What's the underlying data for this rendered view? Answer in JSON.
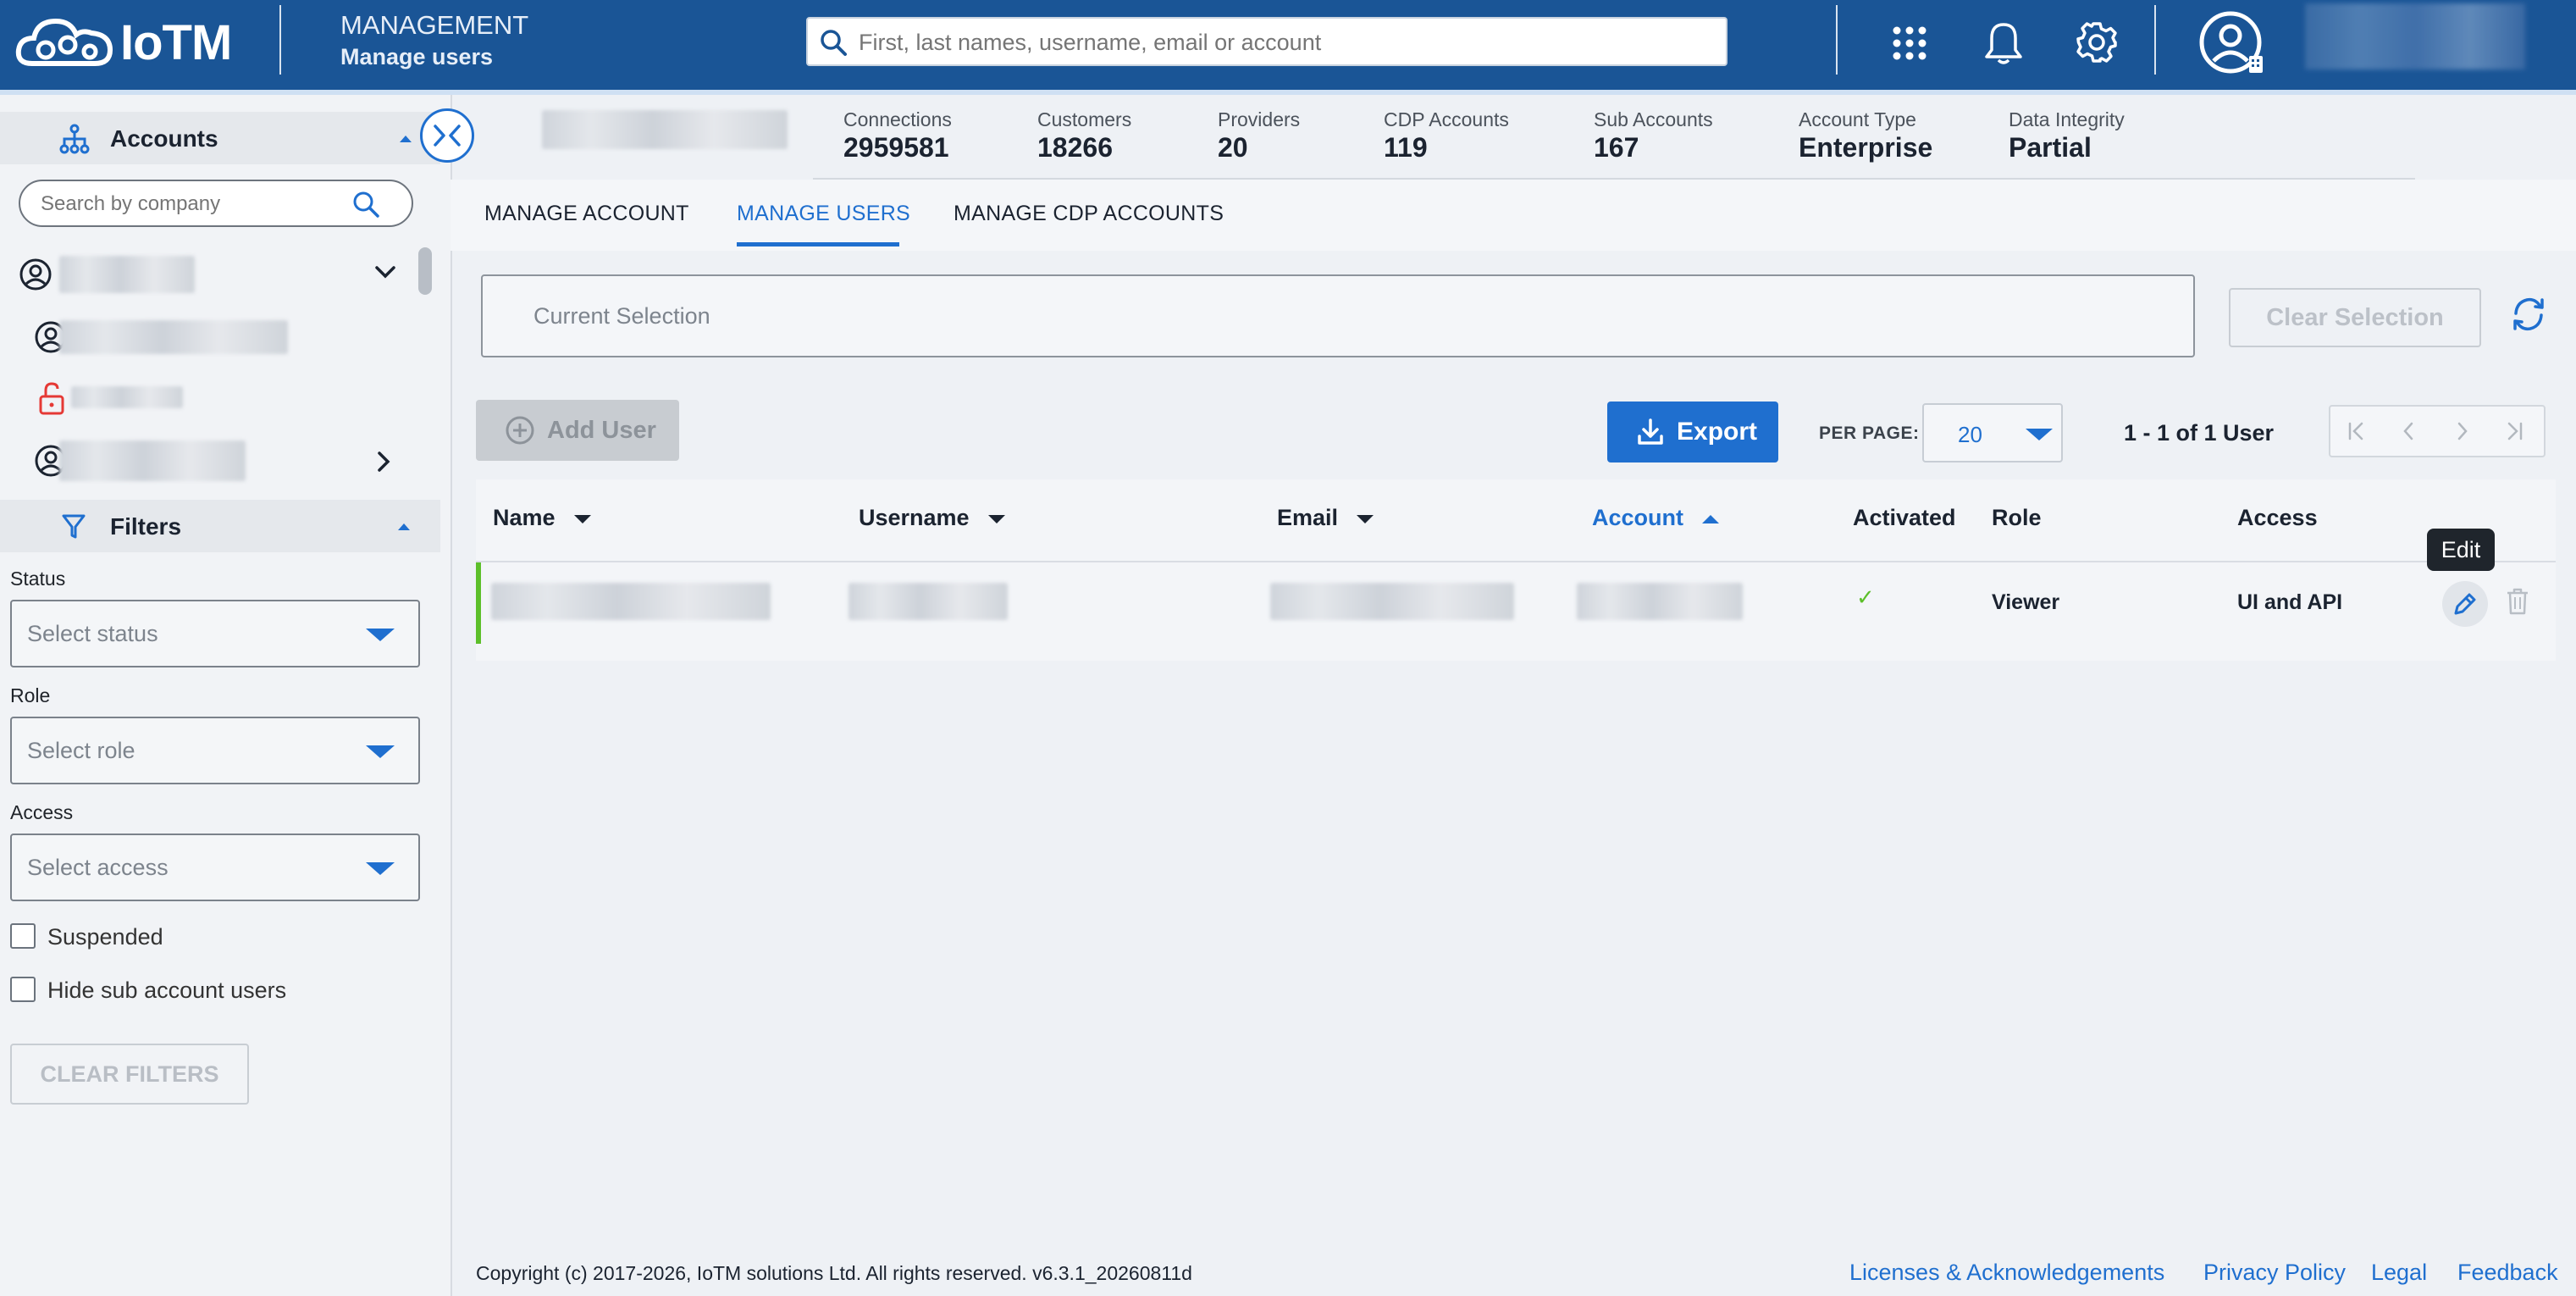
{
  "header": {
    "logo_text": "IoTM",
    "section_title": "MANAGEMENT",
    "section_subtitle": "Manage users",
    "search_placeholder": "First, last names, username, email or account"
  },
  "sidebar": {
    "accounts_label": "Accounts",
    "search_placeholder": "Search by company",
    "filters_label": "Filters",
    "filters": [
      {
        "label": "Status",
        "placeholder": "Select status"
      },
      {
        "label": "Role",
        "placeholder": "Select role"
      },
      {
        "label": "Access",
        "placeholder": "Select access"
      }
    ],
    "suspended_label": "Suspended",
    "hide_sub_label": "Hide sub account users",
    "clear_filters_label": "CLEAR FILTERS"
  },
  "stats": [
    {
      "label": "Connections",
      "value": "2959581"
    },
    {
      "label": "Customers",
      "value": "18266"
    },
    {
      "label": "Providers",
      "value": "20"
    },
    {
      "label": "CDP Accounts",
      "value": "119"
    },
    {
      "label": "Sub Accounts",
      "value": "167"
    },
    {
      "label": "Account Type",
      "value": "Enterprise"
    },
    {
      "label": "Data Integrity",
      "value": "Partial"
    }
  ],
  "tabs": [
    {
      "label": "MANAGE ACCOUNT"
    },
    {
      "label": "MANAGE USERS"
    },
    {
      "label": "MANAGE CDP ACCOUNTS"
    }
  ],
  "selection": {
    "current_label": "Current Selection",
    "clear_label": "Clear Selection"
  },
  "toolbar": {
    "add_user_label": "Add User",
    "export_label": "Export",
    "per_page_label": "PER PAGE:",
    "per_page_value": "20",
    "pagination_text": "1 - 1 of 1 User"
  },
  "table": {
    "columns": [
      "Name",
      "Username",
      "Email",
      "Account",
      "Activated",
      "Role",
      "Access"
    ],
    "rows": [
      {
        "role": "Viewer",
        "access": "UI and API",
        "activated": "✓"
      }
    ],
    "edit_tooltip": "Edit"
  },
  "footer": {
    "copyright": "Copyright (c) 2017-2026, IoTM solutions Ltd. All rights reserved. v6.3.1_20260811d",
    "links": [
      "Licenses & Acknowledgements",
      "Privacy Policy",
      "Legal",
      "Feedback"
    ]
  },
  "colors": {
    "header_bg": "#1a5596",
    "accent": "#1f6fcf",
    "success": "#5cbf2a",
    "danger": "#e53935"
  }
}
